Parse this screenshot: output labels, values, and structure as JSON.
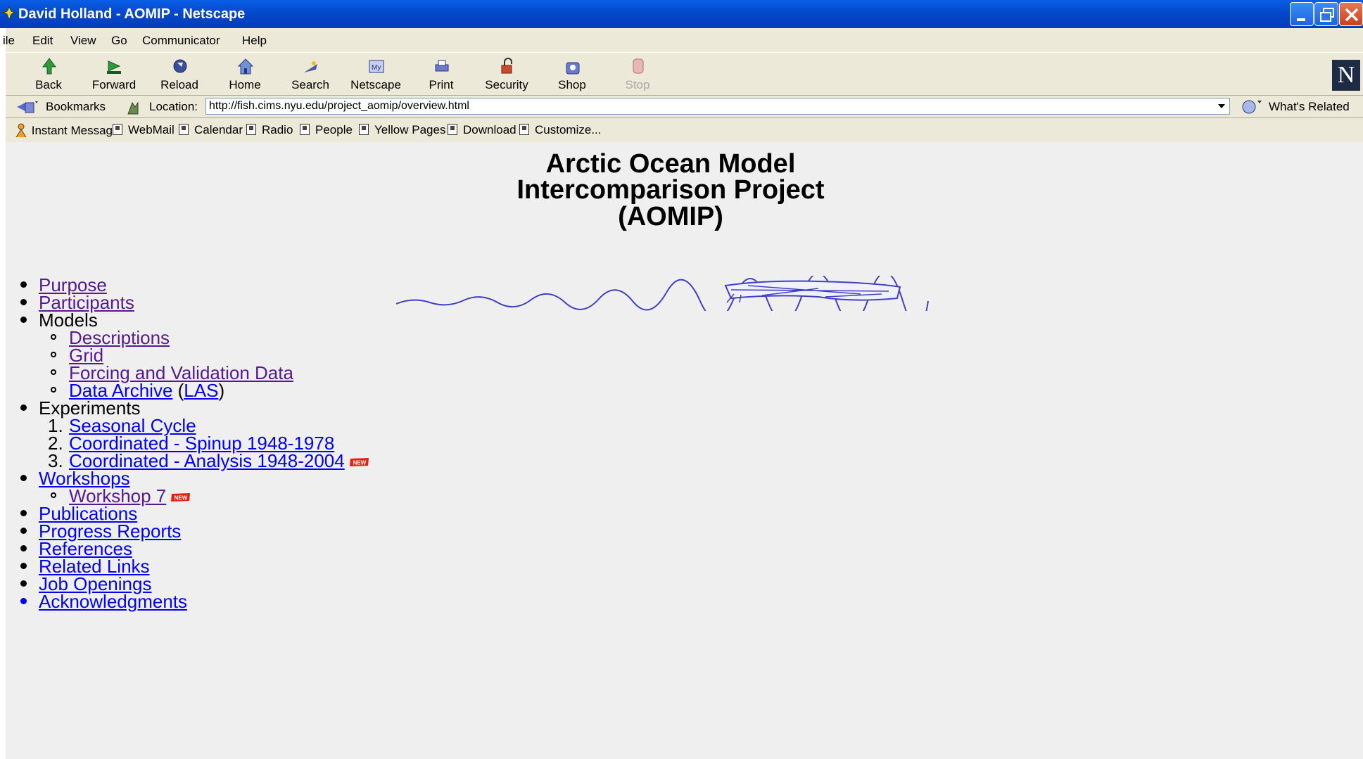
{
  "window": {
    "title": "David Holland - AOMIP - Netscape"
  },
  "menu": [
    "ile",
    "Edit",
    "View",
    "Go",
    "Communicator",
    "Help"
  ],
  "nav_toolbar": [
    {
      "label": "Back",
      "icon": "back-arrow-icon"
    },
    {
      "label": "Forward",
      "icon": "forward-arrow-icon"
    },
    {
      "label": "Reload",
      "icon": "reload-icon"
    },
    {
      "label": "Home",
      "icon": "home-icon"
    },
    {
      "label": "Search",
      "icon": "search-icon"
    },
    {
      "label": "Netscape",
      "icon": "my-netscape-icon"
    },
    {
      "label": "Print",
      "icon": "print-icon"
    },
    {
      "label": "Security",
      "icon": "lock-icon"
    },
    {
      "label": "Shop",
      "icon": "shop-bag-icon"
    },
    {
      "label": "Stop",
      "icon": "stop-icon",
      "disabled": true
    }
  ],
  "location_bar": {
    "bookmarks_label": "Bookmarks",
    "location_label": "Location:",
    "url": "http://fish.cims.nyu.edu/project_aomip/overview.html",
    "whats_related": "What's Related"
  },
  "personal_toolbar": [
    "Instant Message",
    "WebMail",
    "Calendar",
    "Radio",
    "People",
    "Yellow Pages",
    "Download",
    "Customize..."
  ],
  "page": {
    "title_lines": [
      "Arctic Ocean Model",
      "Intercomparison Project",
      "(AOMIP)"
    ],
    "purpose": "Purpose",
    "participants": "Participants",
    "models": "Models",
    "descriptions": "Descriptions",
    "grid": "Grid",
    "forcing": "Forcing and Validation Data",
    "data_archive": "Data Archive",
    "las": "LAS",
    "experiments": "Experiments",
    "exp1": "Seasonal Cycle",
    "exp2": "Coordinated - Spinup 1948-1978",
    "exp3": "Coordinated - Analysis 1948-2004",
    "workshops": "Workshops",
    "workshop7": "Workshop 7",
    "publications": "Publications",
    "progress_reports": "Progress Reports",
    "references": "References",
    "related_links": "Related Links",
    "job_openings": "Job Openings",
    "acknowledgments": "Acknowledgments",
    "new_badge": "NEW",
    "colors": {
      "visited_link": "#551a8b",
      "unvisited_link": "#0000ee",
      "new_badge": "#e02010"
    }
  }
}
